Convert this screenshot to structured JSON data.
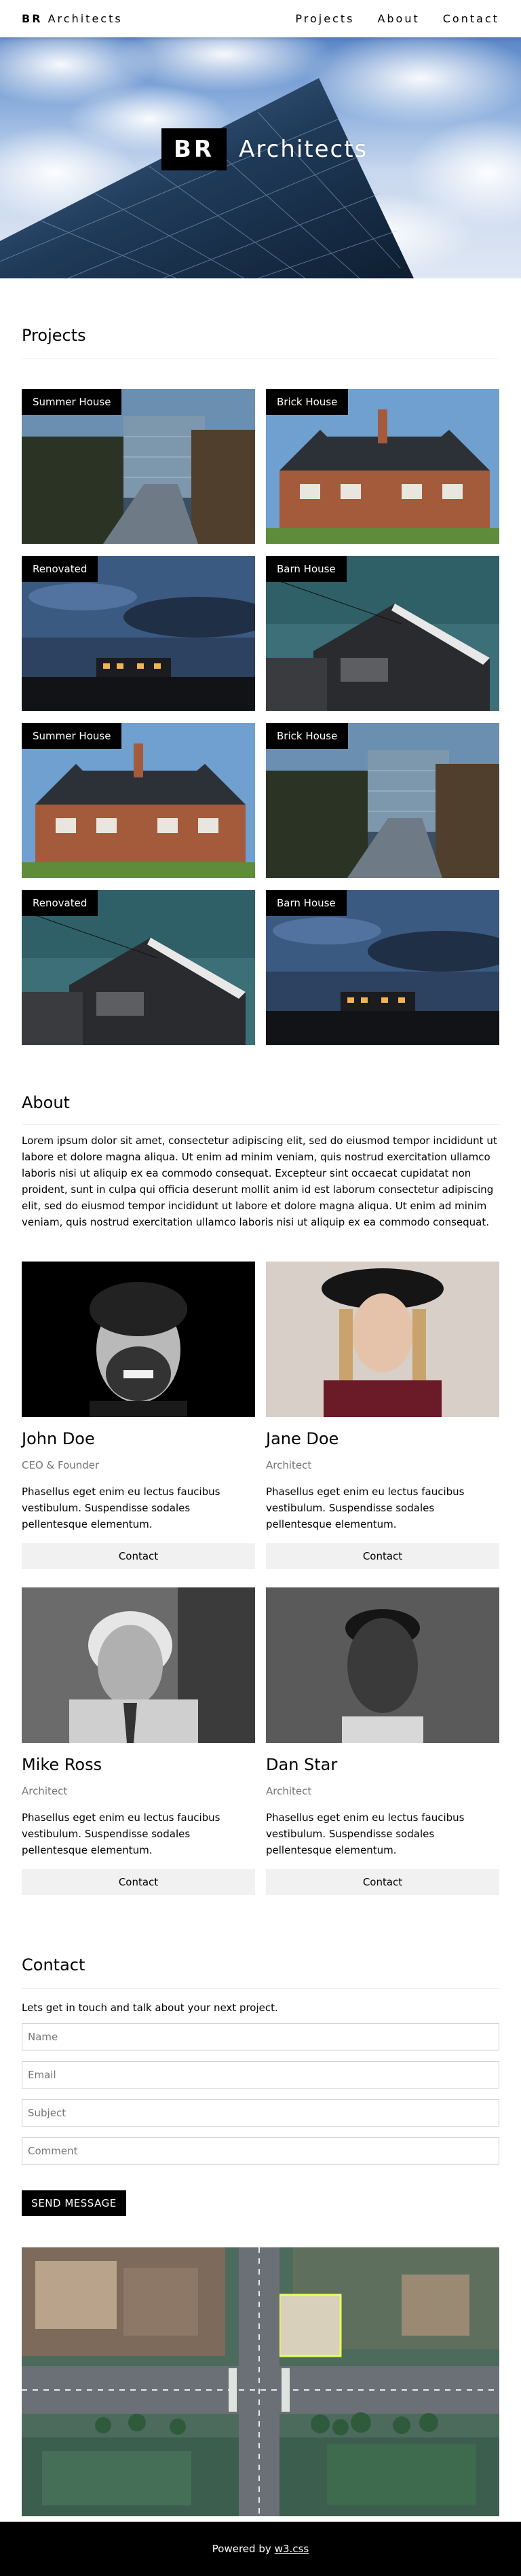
{
  "nav": {
    "brand_bold": "BR",
    "brand_rest": "Architects",
    "links": [
      "Projects",
      "About",
      "Contact"
    ]
  },
  "hero": {
    "badge": "BR",
    "title": "Architects"
  },
  "projects": {
    "title": "Projects",
    "items": [
      {
        "label": "Summer House",
        "image": "summer-house-path"
      },
      {
        "label": "Brick House",
        "image": "brick-house"
      },
      {
        "label": "Renovated",
        "image": "renovated-night"
      },
      {
        "label": "Barn House",
        "image": "barn-house"
      },
      {
        "label": "Summer House",
        "image": "brick-house"
      },
      {
        "label": "Brick House",
        "image": "summer-house-path"
      },
      {
        "label": "Renovated",
        "image": "barn-house"
      },
      {
        "label": "Barn House",
        "image": "renovated-night"
      }
    ]
  },
  "about": {
    "title": "About",
    "text": "Lorem ipsum dolor sit amet, consectetur adipiscing elit, sed do eiusmod tempor incididunt ut labore et dolore magna aliqua. Ut enim ad minim veniam, quis nostrud exercitation ullamco laboris nisi ut aliquip ex ea commodo consequat. Excepteur sint occaecat cupidatat non proident, sunt in culpa qui officia deserunt mollit anim id est laborum consectetur adipiscing elit, sed do eiusmod tempor incididunt ut labore et dolore magna aliqua. Ut enim ad minim veniam, quis nostrud exercitation ullamco laboris nisi ut aliquip ex ea commodo consequat."
  },
  "team": [
    {
      "name": "John Doe",
      "role": "CEO & Founder",
      "bio": "Phasellus eget enim eu lectus faucibus vestibulum. Suspendisse sodales pellentesque elementum.",
      "button": "Contact"
    },
    {
      "name": "Jane Doe",
      "role": "Architect",
      "bio": "Phasellus eget enim eu lectus faucibus vestibulum. Suspendisse sodales pellentesque elementum.",
      "button": "Contact"
    },
    {
      "name": "Mike Ross",
      "role": "Architect",
      "bio": "Phasellus eget enim eu lectus faucibus vestibulum. Suspendisse sodales pellentesque elementum.",
      "button": "Contact"
    },
    {
      "name": "Dan Star",
      "role": "Architect",
      "bio": "Phasellus eget enim eu lectus faucibus vestibulum. Suspendisse sodales pellentesque elementum.",
      "button": "Contact"
    }
  ],
  "contact": {
    "title": "Contact",
    "lead": "Lets get in touch and talk about your next project.",
    "placeholders": {
      "name": "Name",
      "email": "Email",
      "subject": "Subject",
      "comment": "Comment"
    },
    "send": "SEND MESSAGE"
  },
  "footer": {
    "text": "Powered by",
    "link": "w3.css"
  }
}
